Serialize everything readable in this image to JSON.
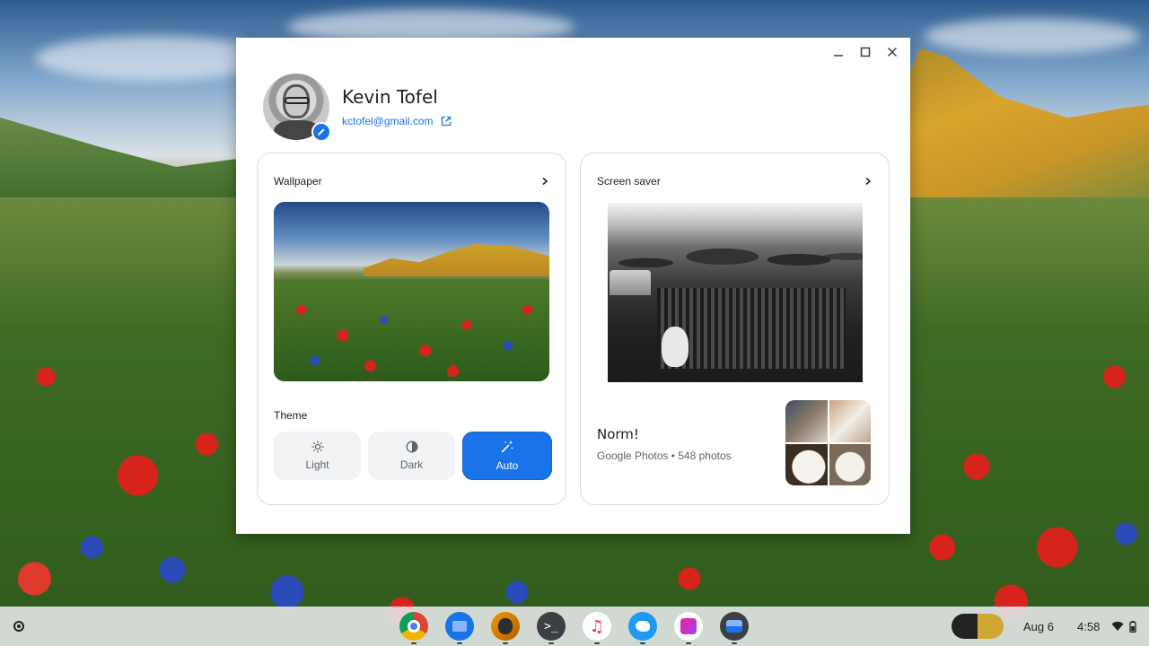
{
  "window": {
    "controls": {
      "minimize": "minimize-icon",
      "maximize": "maximize-icon",
      "close": "close-icon"
    }
  },
  "profile": {
    "name": "Kevin Tofel",
    "email": "kctofel@gmail.com"
  },
  "wallpaper_card": {
    "title": "Wallpaper",
    "theme_label": "Theme",
    "theme_options": [
      {
        "label": "Light",
        "icon": "sun-icon",
        "selected": false
      },
      {
        "label": "Dark",
        "icon": "contrast-icon",
        "selected": false
      },
      {
        "label": "Auto",
        "icon": "auto-magic-icon",
        "selected": true
      }
    ]
  },
  "screensaver_card": {
    "title": "Screen saver",
    "album_title": "Norm!",
    "album_subtitle": "Google Photos • 548 photos"
  },
  "shelf": {
    "apps": [
      {
        "name": "Chrome",
        "icon": "chrome-icon"
      },
      {
        "name": "Files",
        "icon": "files-icon"
      },
      {
        "name": "Avatar app",
        "icon": "avatar-app-icon"
      },
      {
        "name": "Terminal",
        "icon": "terminal-icon",
        "glyph": ">_"
      },
      {
        "name": "Music",
        "icon": "music-icon",
        "glyph": "♫"
      },
      {
        "name": "Twitter",
        "icon": "twitter-icon"
      },
      {
        "name": "Photos",
        "icon": "photos-icon"
      },
      {
        "name": "Wallpaper",
        "icon": "wallpaper-icon"
      }
    ],
    "date": "Aug 6",
    "time": "4:58"
  },
  "colors": {
    "accent": "#1a73e8",
    "card_border": "#dadce0",
    "secondary_text": "#5f6368"
  }
}
